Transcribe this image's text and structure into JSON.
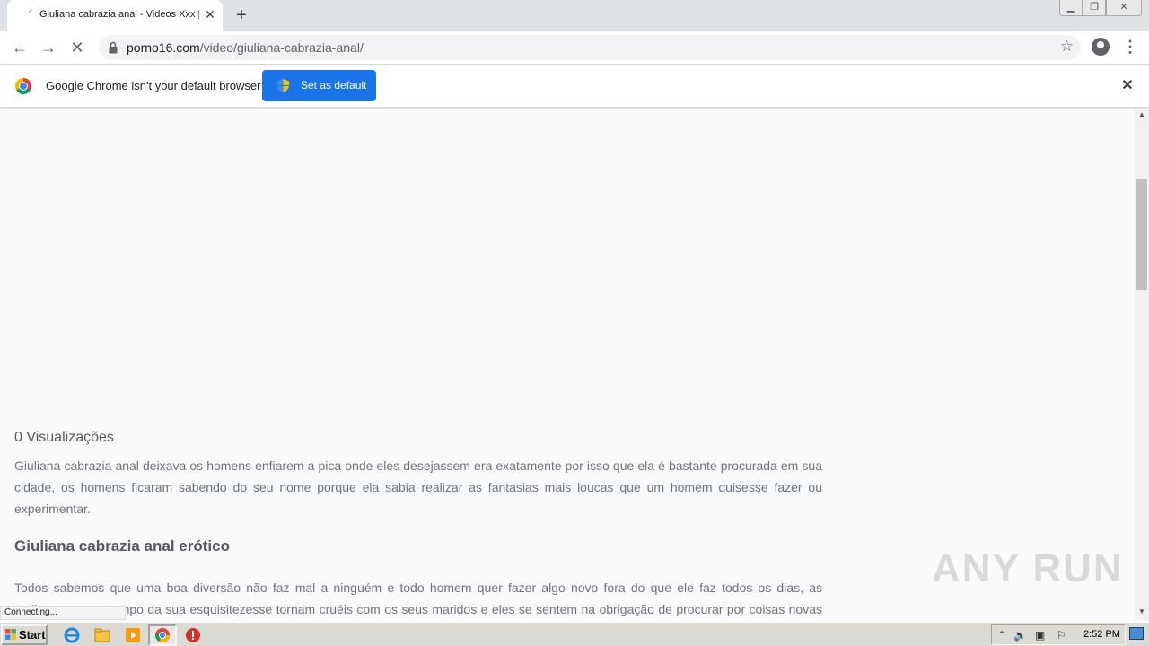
{
  "browser": {
    "tab_title": "Giuliana cabrazia anal - Videos Xxx |",
    "new_tab_label": "+",
    "url_host": "porno16.com",
    "url_path": "/video/giuliana-cabrazia-anal/",
    "icons": [
      "back-icon",
      "forward-icon",
      "stop-loading-icon",
      "lock-icon",
      "star-icon",
      "profile-icon",
      "menu-icon"
    ]
  },
  "infobar": {
    "message": "Google Chrome isn't your default browser",
    "button_label": "Set as default",
    "accent_color": "#1a73e8"
  },
  "page": {
    "views": "0 Visualizações",
    "paragraph1": "Giuliana cabrazia anal deixava os homens enfiarem a pica onde eles desejassem era exatamente por isso que ela é bastante procurada em sua cidade, os homens ficaram sabendo do seu nome porque ela sabia realizar as fantasias mais loucas que um homem quisesse fazer ou experimentar.",
    "heading": "Giuliana cabrazia anal erótico",
    "paragraph2": "Todos sabemos que uma boa diversão não faz mal a ninguém e todo homem quer fazer algo novo fora do que ele faz todos os dias, as mulheres com o tempo da sua esquisitezesse tornam cruéis com os seus maridos e eles se sentem na obrigação de procurar por coisas novas fora do",
    "status": "Connecting...",
    "watermark": "ANY RUN"
  },
  "taskbar": {
    "start_label": "Start",
    "clock": "2:52 PM",
    "pinned": [
      "ie-icon",
      "explorer-icon",
      "media-player-icon",
      "chrome-icon",
      "stop-app-icon"
    ]
  }
}
